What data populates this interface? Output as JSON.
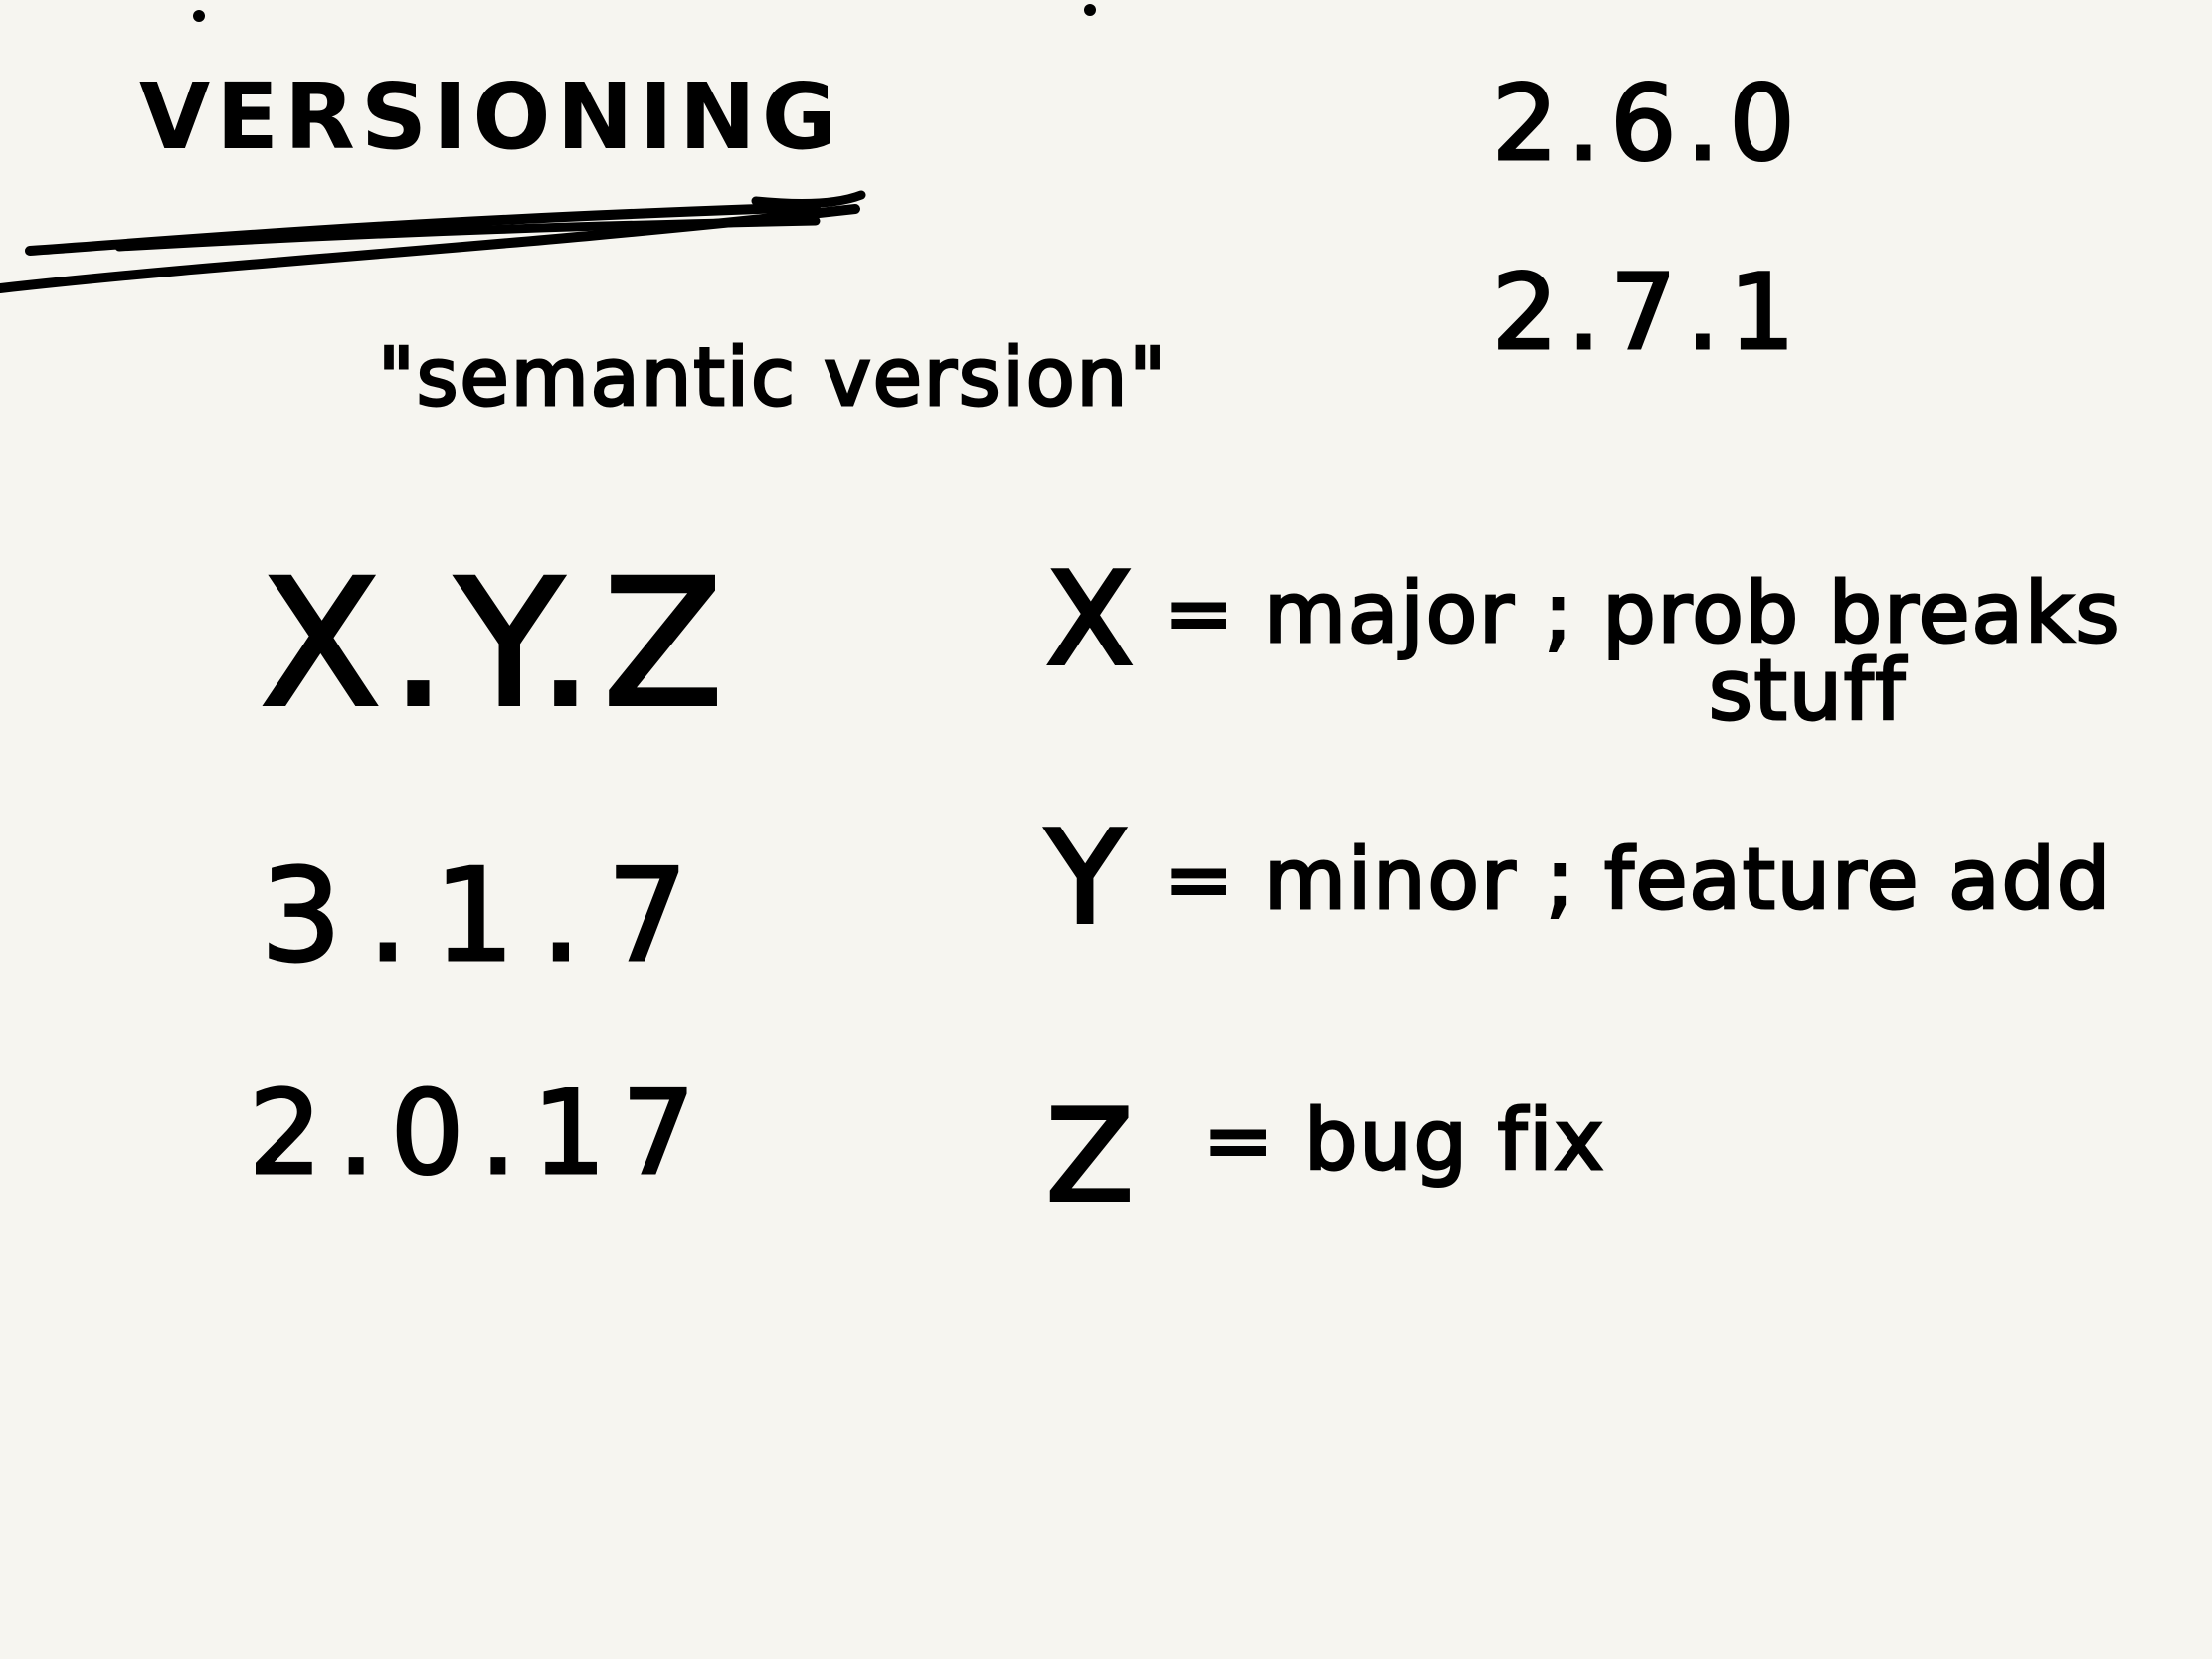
{
  "notes": {
    "title": "VERSIONING",
    "subtitle": "\"semantic version\"",
    "example_versions_top": [
      "2.6.0",
      "2.7.1"
    ],
    "pattern": "X.Y.Z",
    "example_versions_left": [
      "3.1.7",
      "2.0.17"
    ],
    "definitions": [
      {
        "letter": "X",
        "text": "= major ; prob breaks",
        "continued": "stuff"
      },
      {
        "letter": "Y",
        "text": "= minor ; feature add"
      },
      {
        "letter": "Z",
        "text": "= bug fix"
      }
    ]
  },
  "colors": {
    "background": "#f6f5f0",
    "ink": "#000000"
  }
}
